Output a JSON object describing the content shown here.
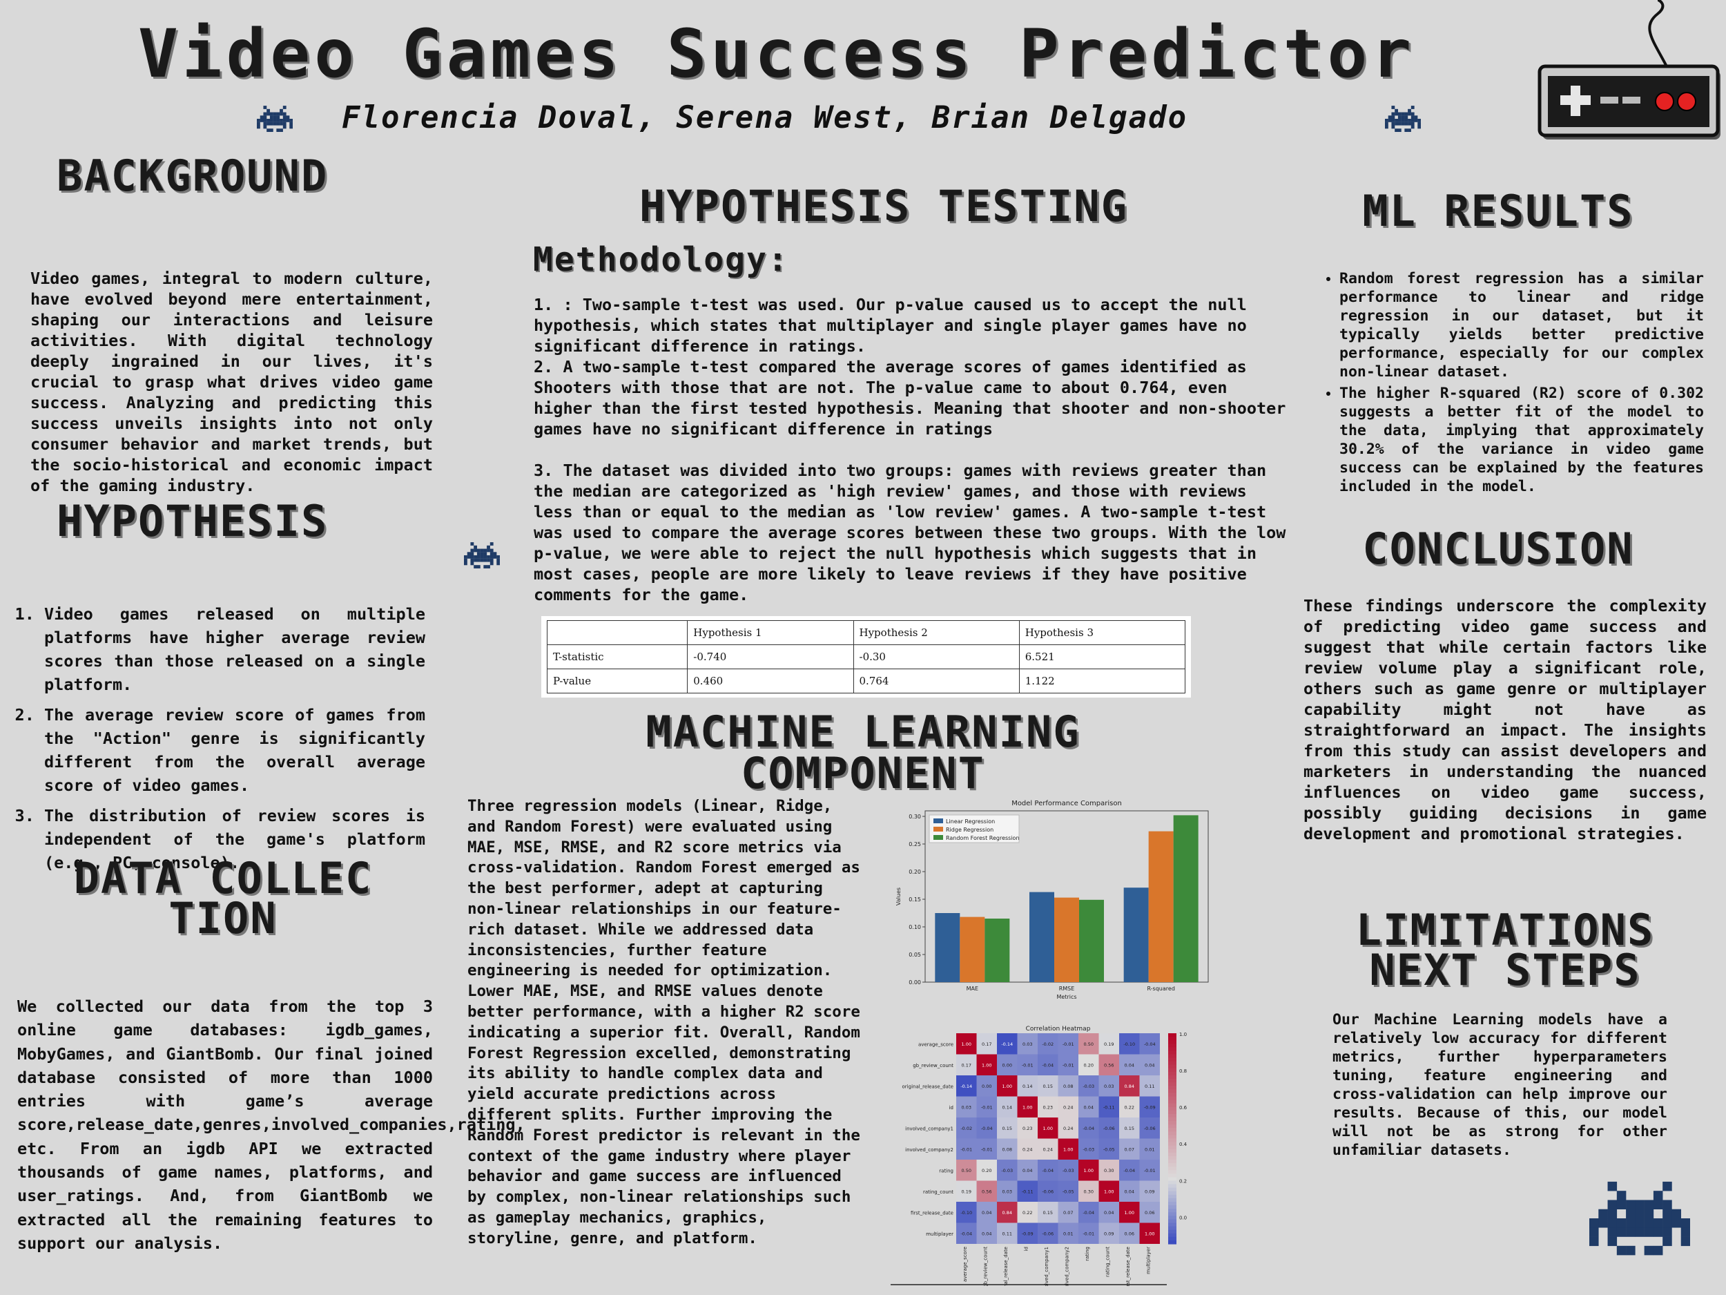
{
  "title": "Video Games Success Predictor",
  "authors": "Florencia Doval, Serena West, Brian Delgado",
  "background": {
    "heading": "BACKGROUND",
    "text": "Video games, integral to modern culture, have evolved beyond mere entertainment, shaping our interactions and leisure activities. With digital technology deeply ingrained in our lives, it's crucial to grasp what drives video game success. Analyzing and predicting this success unveils insights into not only consumer behavior and market trends, but the socio-historical and economic impact of the gaming industry."
  },
  "hypothesis": {
    "heading": "HYPOTHESIS",
    "items": [
      "Video games released on multiple platforms have higher average review scores than those released on a single platform.",
      "The average review score of games from the \"Action\" genre is significantly different from the overall average score of video games.",
      "The distribution of review scores is independent of the game's platform (e.g., PC, console)."
    ]
  },
  "data_collection": {
    "heading": "DATA COLLECTION",
    "text": "We collected our data from the top 3 online game databases: igdb_games, MobyGames, and GiantBomb. Our final joined database consisted of more than 1000 entries with game’s average score,release_date,genres,involved_companies,rating, etc. From an igdb API we extracted thousands of game names, platforms, and user_ratings. And, from GiantBomb we extracted all the remaining features to support our analysis."
  },
  "hypothesis_testing": {
    "heading": "HYPOTHESIS TESTING",
    "subheading": "Methodology:",
    "p1": "1. : Two-sample t-test was used. Our p-value caused us to accept the null hypothesis, which states that multiplayer and single player games have no significant difference in ratings.",
    "p2": "2. A two-sample t-test compared the average scores of games identified as Shooters with those that are not.  The p-value came to about 0.764, even higher than the first tested hypothesis. Meaning that shooter and non-shooter games have no significant difference in ratings",
    "p3": "3. The dataset was  divided into two groups: games with reviews greater than the median are categorized as 'high review' games, and those with reviews less than or equal to the median as 'low review' games. A two-sample t-test was used to compare the average scores between these two groups. With the low p-value, we were able to reject the null hypothesis which suggests that in most cases, people are more likely to leave reviews if they have positive comments for the game.",
    "table": {
      "headers": [
        "",
        "Hypothesis 1",
        "Hypothesis 2",
        "Hypothesis 3"
      ],
      "rows": [
        [
          "T-statistic",
          "-0.740",
          "-0.30",
          "6.521"
        ],
        [
          "P-value",
          "0.460",
          " 0.764",
          "1.122"
        ]
      ]
    }
  },
  "ml_component": {
    "heading": "MACHINE LEARNING COMPONENT",
    "text": "Three regression models (Linear, Ridge, and Random Forest) were evaluated using MAE, MSE, RMSE, and R2 score metrics via cross-validation. Random Forest emerged as the best performer, adept at capturing non-linear relationships in our feature-rich dataset. While we addressed data inconsistencies, further feature engineering is needed for optimization. Lower MAE, MSE, and RMSE values denote better performance, with a higher R2 score indicating a superior fit. Overall, Random Forest Regression excelled, demonstrating its ability to handle complex data and yield accurate predictions across different splits. Further improving the Random Forest predictor is relevant in the context of the game industry where player behavior and game success are influenced by complex, non-linear relationships such as gameplay mechanics, graphics, storyline, genre, and platform."
  },
  "ml_results": {
    "heading": "ML RESULTS",
    "items": [
      "Random forest regression has a similar performance to linear and ridge regression in our dataset, but it typically yields better predictive performance, especially for our complex non-linear dataset.",
      "The higher R-squared (R2) score of 0.302 suggests a better fit of the model to the data, implying that approximately 30.2% of the variance in video game success can be explained by the features included in the model."
    ]
  },
  "conclusion": {
    "heading": "CONCLUSION",
    "text": "These findings underscore the complexity of predicting video game success and suggest that while certain factors like review volume play a significant role, others such as game genre or multiplayer capability might not have as straightforward an impact. The insights from this study can assist developers and marketers in understanding the nuanced influences on video game success, possibly guiding decisions in game development and promotional strategies."
  },
  "limitations": {
    "heading": "LIMITATIONS NEXT STEPS",
    "text": "Our Machine Learning models have a relatively low accuracy for different metrics, further hyperparameters tuning, feature engineering and cross-validation can help improve our results. Because of this, our model will not be as strong for other unfamiliar datasets."
  },
  "colors": {
    "background": "#d9d9d9",
    "invader": "#1f3b66",
    "linear": "#2f5f96",
    "ridge": "#d9762b",
    "forest": "#3d8a3a"
  },
  "icons": [
    "space-invader-icon",
    "game-controller-icon"
  ],
  "chart_data": [
    {
      "type": "bar",
      "title": "Model Performance Comparison",
      "xlabel": "Metrics",
      "ylabel": "Values",
      "categories": [
        "MAE",
        "RMSE",
        "R-squared"
      ],
      "series": [
        {
          "name": "Linear Regression",
          "values": [
            0.125,
            0.163,
            0.171
          ]
        },
        {
          "name": "Ridge Regression",
          "values": [
            0.118,
            0.153,
            0.273
          ]
        },
        {
          "name": "Random Forest Regression",
          "values": [
            0.115,
            0.149,
            0.302
          ]
        }
      ],
      "ylim": [
        0,
        0.31
      ],
      "yticks": [
        "0.00",
        "0.05",
        "0.10",
        "0.15",
        "0.20",
        "0.25",
        "0.30"
      ],
      "legend": "top-left"
    },
    {
      "type": "heatmap",
      "title": "Correlation Heatmap",
      "labels": [
        "average_score",
        "gb_review_count",
        "original_release_date",
        "id",
        "involved_company1",
        "involved_company2",
        "rating",
        "rating_count",
        "first_release_date",
        "multiplayer"
      ],
      "values": [
        [
          1.0,
          0.17,
          -0.14,
          0.03,
          -0.02,
          -0.01,
          0.5,
          0.19,
          -0.1,
          -0.04
        ],
        [
          0.17,
          1.0,
          -0.0,
          -0.01,
          -0.04,
          -0.01,
          0.2,
          0.56,
          0.04,
          0.04
        ],
        [
          -0.14,
          -0.0,
          1.0,
          0.14,
          0.15,
          0.08,
          -0.03,
          0.03,
          0.84,
          0.11
        ],
        [
          0.03,
          -0.01,
          0.14,
          1.0,
          0.23,
          0.24,
          0.04,
          -0.11,
          0.22,
          -0.09
        ],
        [
          -0.02,
          -0.04,
          0.15,
          0.23,
          1.0,
          0.24,
          -0.04,
          -0.06,
          0.15,
          -0.06
        ],
        [
          -0.01,
          -0.01,
          0.08,
          0.24,
          0.24,
          1.0,
          -0.03,
          -0.05,
          0.07,
          0.01
        ],
        [
          0.5,
          0.2,
          -0.03,
          0.04,
          -0.04,
          -0.03,
          1.0,
          0.3,
          -0.04,
          -0.01
        ],
        [
          0.19,
          0.56,
          0.03,
          -0.11,
          -0.06,
          -0.05,
          0.3,
          1.0,
          0.04,
          0.09
        ],
        [
          -0.1,
          0.04,
          0.84,
          0.22,
          0.15,
          0.07,
          -0.04,
          0.04,
          1.0,
          0.06
        ],
        [
          -0.04,
          0.04,
          0.11,
          -0.09,
          -0.06,
          0.01,
          -0.01,
          0.09,
          0.06,
          1.0
        ]
      ],
      "colorbar_ticks": [
        "1.0",
        "0.8",
        "0.6",
        "0.4",
        "0.2",
        "0.0"
      ]
    }
  ]
}
